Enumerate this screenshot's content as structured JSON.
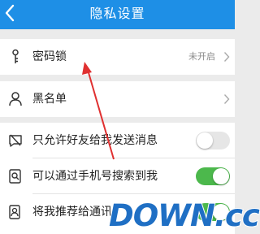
{
  "header": {
    "title": "隐私设置",
    "back_icon": "back-arrow-icon",
    "background": "#1e8fe6"
  },
  "rows": [
    {
      "label": "密码锁",
      "value": "未开启",
      "icon": "key-icon"
    },
    {
      "label": "黑名单",
      "icon": "person-icon"
    },
    {
      "label": "只允许好友给我发送消息",
      "icon": "message-block-icon",
      "toggle": "off"
    },
    {
      "label": "可以通过手机号搜索到我",
      "icon": "phone-search-icon",
      "toggle": "on"
    },
    {
      "label": "将我推荐给通讯",
      "icon": "contact-recommend-icon",
      "toggle": "on"
    }
  ],
  "annotation": {
    "color": "#e03030"
  },
  "watermark": {
    "text": "DOWN.cc"
  }
}
